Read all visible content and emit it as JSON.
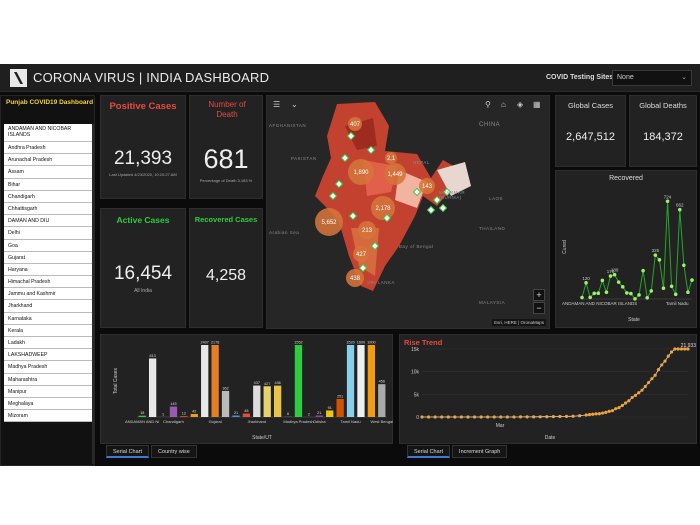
{
  "header": {
    "title": "CORONA VIRUS | INDIA DASHBOARD",
    "testing_label": "COVID Testing Sites",
    "testing_value": "None"
  },
  "sidebar": {
    "title": "Punjab COVID19 Dashboard",
    "states": [
      "ANDAMAN AND NICOBAR ISLANDS",
      "Andhra Pradesh",
      "Arunachal Pradesh",
      "Assam",
      "Bihar",
      "Chandigarh",
      "Chhattisgarh",
      "DAMAN AND DIU",
      "Delhi",
      "Goa",
      "Gujarat",
      "Haryana",
      "Himachal Pradesh",
      "Jammu and Kashmir",
      "Jharkhand",
      "Karnataka",
      "Kerala",
      "Ladakh",
      "LAKSHADWEEP",
      "Madhya Pradesh",
      "Maharashtra",
      "Manipur",
      "Meghalaya",
      "Mizoram"
    ]
  },
  "stats": {
    "positive": {
      "label": "Positive Cases",
      "value": "21,393",
      "note": "Last Updated 4/23/2020, 10:10:27 AM"
    },
    "deaths": {
      "label": "Number of Death",
      "value": "681",
      "note": "Percentage of Death 3.183 %"
    },
    "active": {
      "label": "Active Cases",
      "value": "16,454",
      "note": "All India"
    },
    "recovered": {
      "label": "Recovered Cases",
      "value": "4,258"
    },
    "global_cases": {
      "label": "Global Cases",
      "value": "2,647,512"
    },
    "global_deaths": {
      "label": "Global Deaths",
      "value": "184,372"
    }
  },
  "map": {
    "labels": {
      "afghanistan": "AFGHANISTAN",
      "china": "CHINA",
      "pakistan": "PAKISTAN",
      "nepal": "NEPAL",
      "myanmar": "MYANMAR (BURMA)",
      "arabian": "Arabian Sea",
      "bengal": "Bay of Bengal",
      "srilanka": "SRI LANKA",
      "malaysia": "MALAYSIA",
      "thailand": "THAILAND",
      "laos": "LAOS"
    },
    "attribution": "Esri, HERE | OronaMaps",
    "bubble_labels": [
      "407",
      "1,890",
      "1,449",
      "5,652",
      "2,178",
      "143",
      "213",
      "427",
      "438",
      "2,1"
    ]
  },
  "colors": {
    "positive": "#e84b3c",
    "deaths": "#e84b3c",
    "active": "#2ecc40",
    "recovered": "#2ecc40",
    "rise": "#e84b3c",
    "trend_line": "#dddddd",
    "trend_marker": "#f0a33a"
  },
  "chart_data": [
    {
      "type": "line",
      "title": "Recovered",
      "xlabel": "State",
      "ylabel": "Cured",
      "ylim": [
        0,
        800
      ],
      "categories": [
        "ANDAMAN AND NICOBAR ISLANDS",
        "Tamil Nadu"
      ],
      "series": [
        {
          "values": [
            11,
            120,
            12,
            42,
            43,
            138,
            50,
            170,
            180,
            125,
            90,
            45,
            40,
            1,
            30,
            210,
            9,
            60,
            325,
            290,
            80,
            724,
            94,
            35,
            662,
            250,
            50,
            140
          ]
        }
      ]
    },
    {
      "type": "bar",
      "xlabel": "State/UT",
      "ylabel": "Total Cases",
      "ylim": [
        0,
        1000
      ],
      "categories": [
        "ANDAMAN AND NICOBAR ISLANDS",
        "Chandigarh",
        "Gujarat",
        "Jharkhand",
        "Madhya Pradesh",
        "Odisha",
        "Tamil Nadu",
        "West Bengal"
      ],
      "values": [
        18,
        813,
        1,
        145,
        12,
        42,
        2407,
        2178,
        362,
        21,
        48,
        437,
        427,
        436,
        6,
        1552,
        2,
        21,
        91,
        251,
        1520,
        1600,
        1000,
        456
      ],
      "labels": [
        "18",
        "813",
        "1",
        "145",
        "12",
        "42",
        "2407",
        "2178",
        "362",
        "21",
        "48",
        "437",
        "427",
        "436",
        "6",
        "1552",
        "2",
        "21",
        "91",
        "251",
        "1520",
        "1600",
        "1000",
        "456"
      ]
    },
    {
      "type": "line",
      "title": "Rise Trend",
      "xlabel": "Date",
      "ylim": [
        0,
        15000
      ],
      "yticks": [
        "0",
        "5k",
        "10k",
        "15k"
      ],
      "xtick": "Mar",
      "last_value": "21,933",
      "series": [
        {
          "values": [
            3,
            3,
            3,
            3,
            3,
            3,
            3,
            3,
            3,
            3,
            3,
            3,
            3,
            3,
            3,
            3,
            3,
            3,
            3,
            3,
            3,
            3,
            3,
            3,
            3,
            3,
            3,
            3,
            5,
            6,
            28,
            29,
            30,
            31,
            34,
            39,
            43,
            56,
            62,
            73,
            82,
            102,
            113,
            119,
            137,
            151,
            173,
            223,
            283,
            360,
            434,
            519,
            606,
            694,
            724,
            873,
            1024,
            1251,
            1397,
            1834,
            2069,
            2547,
            3082,
            3588,
            4289,
            4778,
            5351,
            5916,
            6725,
            7600,
            8446,
            9205,
            10453,
            11487,
            12322,
            13430,
            14352,
            15722,
            17615,
            18539,
            20080,
            21933
          ]
        }
      ]
    }
  ],
  "tabs": {
    "bar": [
      "Serial Chart",
      "Country wise"
    ],
    "trend": [
      "Serial Chart",
      "Increment Graph"
    ]
  }
}
